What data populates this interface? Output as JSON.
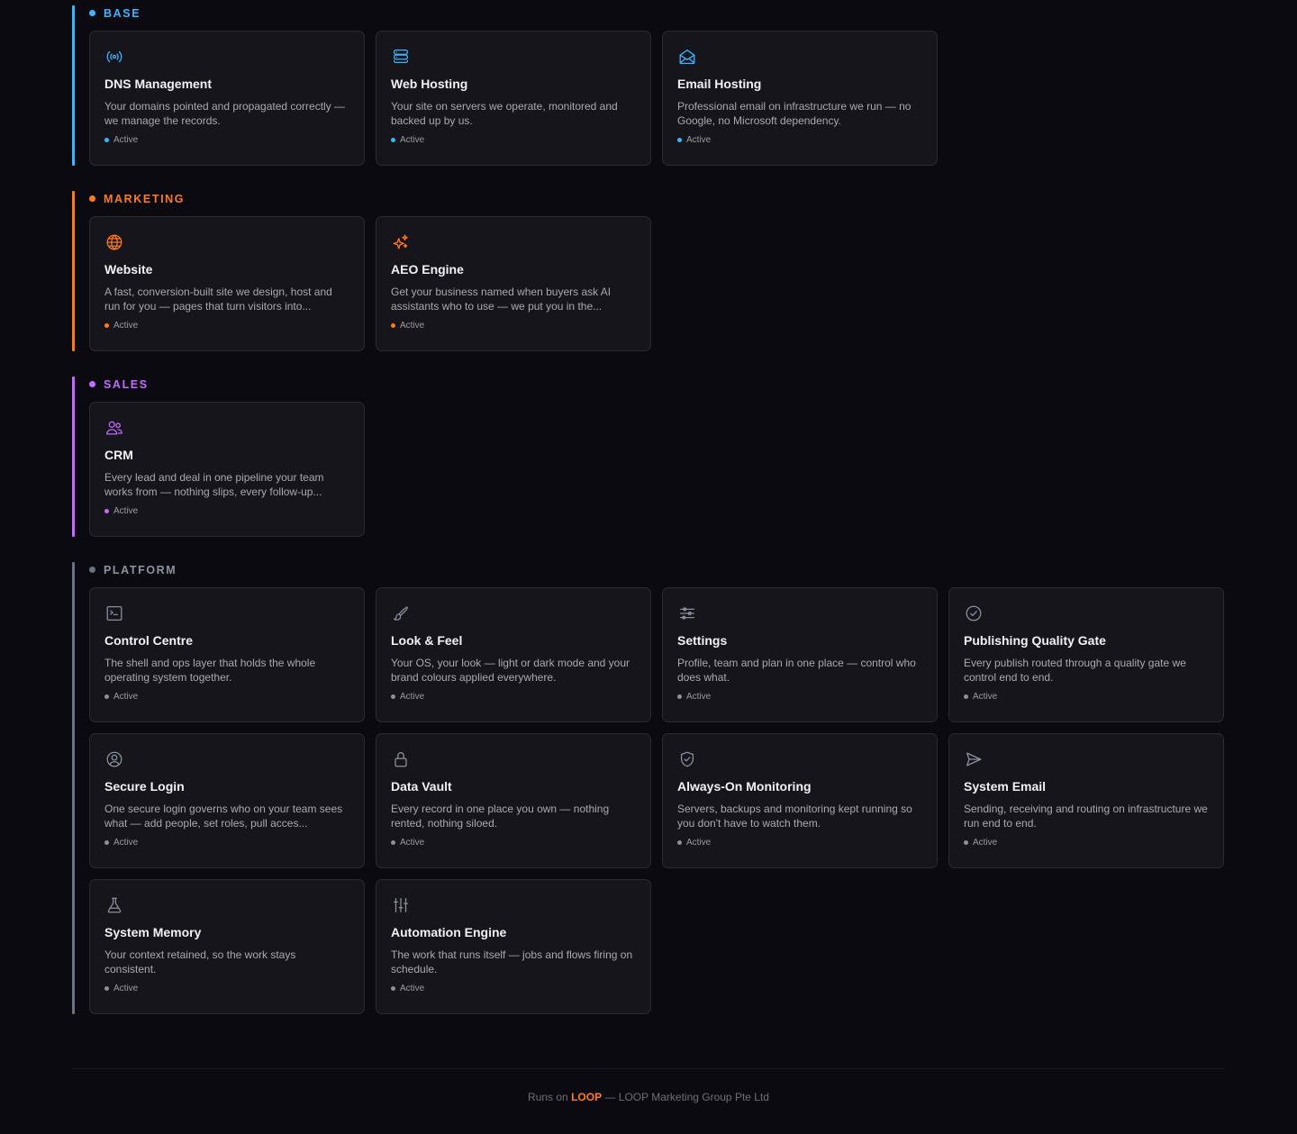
{
  "colors": {
    "base": "#38b6ff",
    "marketing": "#ff7a1a",
    "sales": "#c16bff",
    "platform": "#6b7280"
  },
  "sections": [
    {
      "key": "base",
      "label": "BASE",
      "color": "#38b6ff",
      "cards": [
        {
          "icon": "broadcast-icon",
          "title": "DNS Management",
          "desc": "Your domains pointed and propagated correctly — we manage the records.",
          "status": "Active"
        },
        {
          "icon": "server-stack-icon",
          "title": "Web Hosting",
          "desc": "Your site on servers we operate, monitored and backed up by us.",
          "status": "Active"
        },
        {
          "icon": "envelope-open-icon",
          "title": "Email Hosting",
          "desc": "Professional email on infrastructure we run — no Google, no Microsoft dependency.",
          "status": "Active"
        }
      ]
    },
    {
      "key": "marketing",
      "label": "MARKETING",
      "color": "#ff7a1a",
      "cards": [
        {
          "icon": "globe-icon",
          "title": "Website",
          "desc": "A fast, conversion-built site we design, host and run for you — pages that turn visitors into...",
          "status": "Active"
        },
        {
          "icon": "sparkles-icon",
          "title": "AEO Engine",
          "desc": "Get your business named when buyers ask AI assistants who to use — we put you in the...",
          "status": "Active"
        }
      ]
    },
    {
      "key": "sales",
      "label": "SALES",
      "color": "#c16bff",
      "cards": [
        {
          "icon": "users-icon",
          "title": "CRM",
          "desc": "Every lead and deal in one pipeline your team works from — nothing slips, every follow-up...",
          "status": "Active"
        }
      ]
    },
    {
      "key": "platform",
      "label": "PLATFORM",
      "color": "#6b7280",
      "cards": [
        {
          "icon": "terminal-icon",
          "title": "Control Centre",
          "desc": "The shell and ops layer that holds the whole operating system together.",
          "status": "Active"
        },
        {
          "icon": "paintbrush-icon",
          "title": "Look & Feel",
          "desc": "Your OS, your look — light or dark mode and your brand colours applied everywhere.",
          "status": "Active"
        },
        {
          "icon": "sliders-icon",
          "title": "Settings",
          "desc": "Profile, team and plan in one place — control who does what.",
          "status": "Active"
        },
        {
          "icon": "check-circle-icon",
          "title": "Publishing Quality Gate",
          "desc": "Every publish routed through a quality gate we control end to end.",
          "status": "Active"
        },
        {
          "icon": "user-circle-icon",
          "title": "Secure Login",
          "desc": "One secure login governs who on your team sees what — add people, set roles, pull acces...",
          "status": "Active"
        },
        {
          "icon": "lock-icon",
          "title": "Data Vault",
          "desc": "Every record in one place you own — nothing rented, nothing siloed.",
          "status": "Active"
        },
        {
          "icon": "shield-check-icon",
          "title": "Always-On Monitoring",
          "desc": "Servers, backups and monitoring kept running so you don't have to watch them.",
          "status": "Active"
        },
        {
          "icon": "paper-plane-icon",
          "title": "System Email",
          "desc": "Sending, receiving and routing on infrastructure we run end to end.",
          "status": "Active"
        },
        {
          "icon": "beaker-icon",
          "title": "System Memory",
          "desc": "Your context retained, so the work stays consistent.",
          "status": "Active"
        },
        {
          "icon": "adjustments-icon",
          "title": "Automation Engine",
          "desc": "The work that runs itself — jobs and flows firing on schedule.",
          "status": "Active"
        }
      ]
    }
  ],
  "footer": {
    "prefix": "Runs on",
    "brand": "LOOP",
    "suffix": "— LOOP Marketing Group Pte Ltd"
  }
}
